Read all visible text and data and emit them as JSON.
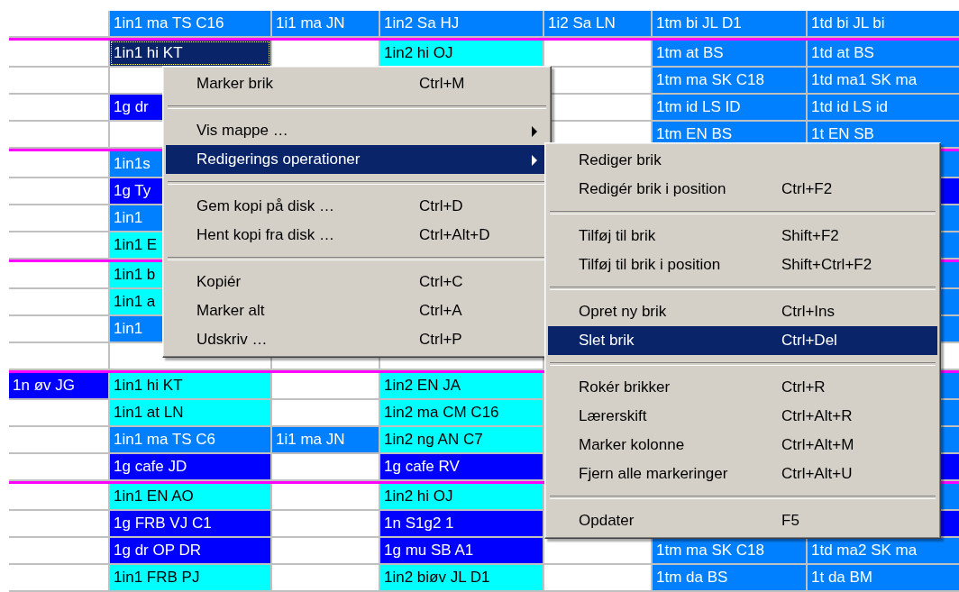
{
  "schedule": {
    "blocks": [
      {
        "rows": [
          {
            "cells": [
              null,
              {
                "text": "1in1 ma TS C16",
                "color": "#0080ff",
                "selected": false
              },
              {
                "text": "1i1 ma JN",
                "color": "#0080ff",
                "selected": false
              },
              {
                "text": "1in2 Sa HJ",
                "color": "#0080ff",
                "selected": false
              },
              {
                "text": "1i2 Sa LN",
                "color": "#0080ff",
                "selected": false
              },
              {
                "text": "1tm bi JL D1",
                "color": "#0080ff",
                "selected": false
              },
              {
                "text": "1td bi JL bi",
                "color": "#0080ff",
                "selected": false
              }
            ]
          }
        ]
      },
      {
        "rows": [
          {
            "cells": [
              null,
              {
                "text": "1in1 hi KT",
                "color": "#0a246a",
                "selected": true
              },
              null,
              {
                "text": "1in2 hi OJ",
                "color": "#00ffff",
                "selected": false
              },
              null,
              {
                "text": "1tm at BS",
                "color": "#0080ff",
                "selected": false
              },
              {
                "text": "1td at BS",
                "color": "#0080ff",
                "selected": false
              }
            ]
          },
          {
            "cells": [
              null,
              null,
              null,
              null,
              null,
              {
                "text": "1tm ma SK C18",
                "color": "#0080ff",
                "selected": false
              },
              {
                "text": "1td ma1 SK ma",
                "color": "#0080ff",
                "selected": false
              }
            ]
          },
          {
            "cells": [
              null,
              {
                "text": "1g dr",
                "color": "#0000ff",
                "selected": false
              },
              null,
              null,
              null,
              {
                "text": "1tm id LS ID",
                "color": "#0080ff",
                "selected": false
              },
              {
                "text": "1td id LS id",
                "color": "#0080ff",
                "selected": false
              }
            ]
          },
          {
            "cells": [
              null,
              null,
              null,
              null,
              null,
              {
                "text": "1tm EN BS",
                "color": "#0080ff",
                "selected": false
              },
              {
                "text": "1t EN SB",
                "color": "#0080ff",
                "selected": false
              }
            ]
          }
        ]
      },
      {
        "rows": [
          {
            "cells": [
              null,
              {
                "text": "1in1s",
                "color": "#0080ff",
                "selected": false
              },
              null,
              null,
              null,
              null,
              {
                "color": "#0080ff",
                "selected": false
              }
            ]
          },
          {
            "cells": [
              null,
              {
                "text": "1g Ty",
                "color": "#0000ff",
                "selected": false
              },
              null,
              null,
              null,
              null,
              {
                "color": "#0000ff",
                "selected": false
              }
            ]
          },
          {
            "cells": [
              null,
              {
                "text": "1in1",
                "color": "#0080ff",
                "selected": false
              },
              null,
              null,
              null,
              null,
              {
                "color": "#0080ff",
                "selected": false
              }
            ]
          },
          {
            "cells": [
              null,
              {
                "text": "1in1 E",
                "color": "#00ffff",
                "selected": false
              },
              null,
              null,
              null,
              null,
              {
                "color": "#0080ff",
                "selected": false
              }
            ]
          }
        ]
      },
      {
        "rows": [
          {
            "cells": [
              null,
              {
                "text": "1in1 b",
                "color": "#00ffff",
                "selected": false
              },
              null,
              null,
              null,
              null,
              {
                "color": "#0080ff",
                "selected": false
              }
            ]
          },
          {
            "cells": [
              null,
              {
                "text": "1in1 a",
                "color": "#00ffff",
                "selected": false
              },
              null,
              null,
              null,
              null,
              {
                "color": "#0080ff",
                "selected": false
              }
            ]
          },
          {
            "cells": [
              null,
              {
                "text": "1in1",
                "color": "#0080ff",
                "selected": false
              },
              null,
              null,
              null,
              null,
              {
                "color": "#0080ff",
                "selected": false
              }
            ]
          },
          {
            "cells": [
              null,
              null,
              null,
              null,
              null,
              null,
              null
            ]
          }
        ]
      },
      {
        "rows": [
          {
            "cells": [
              {
                "text": "1n øv JG",
                "color": "#0000ff",
                "selected": false
              },
              {
                "text": "1in1 hi KT",
                "color": "#00ffff",
                "selected": false
              },
              null,
              {
                "text": "1in2 EN JA",
                "color": "#00ffff",
                "selected": false
              },
              null,
              null,
              {
                "color": "#0080ff",
                "selected": false
              }
            ]
          },
          {
            "cells": [
              null,
              {
                "text": "1in1 at LN",
                "color": "#00ffff",
                "selected": false
              },
              null,
              {
                "text": "1in2 ma CM C16",
                "color": "#00ffff",
                "selected": false
              },
              null,
              null,
              {
                "color": "#0080ff",
                "selected": false
              }
            ]
          },
          {
            "cells": [
              null,
              {
                "text": "1in1 ma TS C6",
                "color": "#0080ff",
                "selected": false
              },
              {
                "text": "1i1 ma JN",
                "color": "#0080ff",
                "selected": false
              },
              {
                "text": "1in2 ng AN C7",
                "color": "#00ffff",
                "selected": false
              },
              null,
              null,
              {
                "color": "#0080ff",
                "selected": false
              }
            ]
          },
          {
            "cells": [
              null,
              {
                "text": "1g cafe JD",
                "color": "#0000ff",
                "selected": false
              },
              null,
              {
                "text": "1g cafe RV",
                "color": "#0000ff",
                "selected": false
              },
              null,
              null,
              {
                "color": "#0000ff",
                "selected": false
              }
            ]
          }
        ]
      },
      {
        "rows": [
          {
            "cells": [
              null,
              {
                "text": "1in1 EN AO",
                "color": "#00ffff",
                "selected": false
              },
              null,
              {
                "text": "1in2 hi OJ",
                "color": "#00ffff",
                "selected": false
              },
              null,
              null,
              {
                "color": "#0080ff",
                "selected": false
              }
            ]
          },
          {
            "cells": [
              null,
              {
                "text": "1g FRB VJ C1",
                "color": "#0000ff",
                "selected": false
              },
              null,
              {
                "text": "1n  S1g2 1",
                "color": "#0000ff",
                "selected": false
              },
              null,
              null,
              {
                "color": "#0000ff",
                "selected": false
              }
            ]
          },
          {
            "cells": [
              null,
              {
                "text": "1g dr OP DR",
                "color": "#0000ff",
                "selected": false
              },
              null,
              {
                "text": "1g mu SB A1",
                "color": "#0000ff",
                "selected": false
              },
              null,
              {
                "text": "1tm ma SK C18",
                "color": "#0080ff",
                "selected": false
              },
              {
                "text": "1td ma2 SK ma",
                "color": "#0080ff",
                "selected": false
              }
            ]
          },
          {
            "cells": [
              null,
              {
                "text": "1in1 FRB PJ",
                "color": "#00ffff",
                "selected": false
              },
              null,
              {
                "text": "1in2 biøv JL D1",
                "color": "#00ffff",
                "selected": false
              },
              null,
              {
                "text": "1tm da BS",
                "color": "#0080ff",
                "selected": false
              },
              {
                "text": "1t da BM",
                "color": "#0080ff",
                "selected": false
              }
            ]
          }
        ]
      }
    ]
  },
  "context_menu": {
    "items": [
      {
        "kind": "item",
        "label": "Marker brik",
        "shortcut": "Ctrl+M",
        "has_submenu": false,
        "selected": false
      },
      {
        "kind": "separator"
      },
      {
        "kind": "item",
        "label": "Vis mappe …",
        "has_submenu": true,
        "selected": false
      },
      {
        "kind": "item",
        "label": "Redigerings operationer",
        "has_submenu": true,
        "selected": true
      },
      {
        "kind": "separator"
      },
      {
        "kind": "item",
        "label": "Gem kopi på disk …",
        "shortcut": "Ctrl+D",
        "has_submenu": false,
        "selected": false
      },
      {
        "kind": "item",
        "label": "Hent kopi fra disk …",
        "shortcut": "Ctrl+Alt+D",
        "has_submenu": false,
        "selected": false
      },
      {
        "kind": "separator"
      },
      {
        "kind": "item",
        "label": "Kopiér",
        "shortcut": "Ctrl+C",
        "has_submenu": false,
        "selected": false
      },
      {
        "kind": "item",
        "label": "Marker alt",
        "shortcut": "Ctrl+A",
        "has_submenu": false,
        "selected": false
      },
      {
        "kind": "item",
        "label": "Udskriv …",
        "shortcut": "Ctrl+P",
        "has_submenu": false,
        "selected": false
      }
    ]
  },
  "submenu": {
    "items": [
      {
        "kind": "item",
        "label": "Rediger brik",
        "selected": false
      },
      {
        "kind": "item",
        "label": "Redigér brik i position",
        "shortcut": "Ctrl+F2",
        "selected": false
      },
      {
        "kind": "separator"
      },
      {
        "kind": "item",
        "label": "Tilføj til brik",
        "shortcut": "Shift+F2",
        "selected": false
      },
      {
        "kind": "item",
        "label": "Tilføj til brik i position",
        "shortcut": "Shift+Ctrl+F2",
        "selected": false
      },
      {
        "kind": "separator"
      },
      {
        "kind": "item",
        "label": "Opret ny brik",
        "shortcut": "Ctrl+Ins",
        "selected": false
      },
      {
        "kind": "item",
        "label": "Slet brik",
        "shortcut": "Ctrl+Del",
        "selected": true
      },
      {
        "kind": "separator"
      },
      {
        "kind": "item",
        "label": "Rokér brikker",
        "shortcut": "Ctrl+R",
        "selected": false
      },
      {
        "kind": "item",
        "label": "Lærerskift",
        "shortcut": "Ctrl+Alt+R",
        "selected": false
      },
      {
        "kind": "item",
        "label": "Marker kolonne",
        "shortcut": "Ctrl+Alt+M",
        "selected": false
      },
      {
        "kind": "item",
        "label": "Fjern alle markeringer",
        "shortcut": "Ctrl+Alt+U",
        "selected": false
      },
      {
        "kind": "separator"
      },
      {
        "kind": "item",
        "label": "Opdater",
        "shortcut": "F5",
        "selected": false
      }
    ]
  }
}
